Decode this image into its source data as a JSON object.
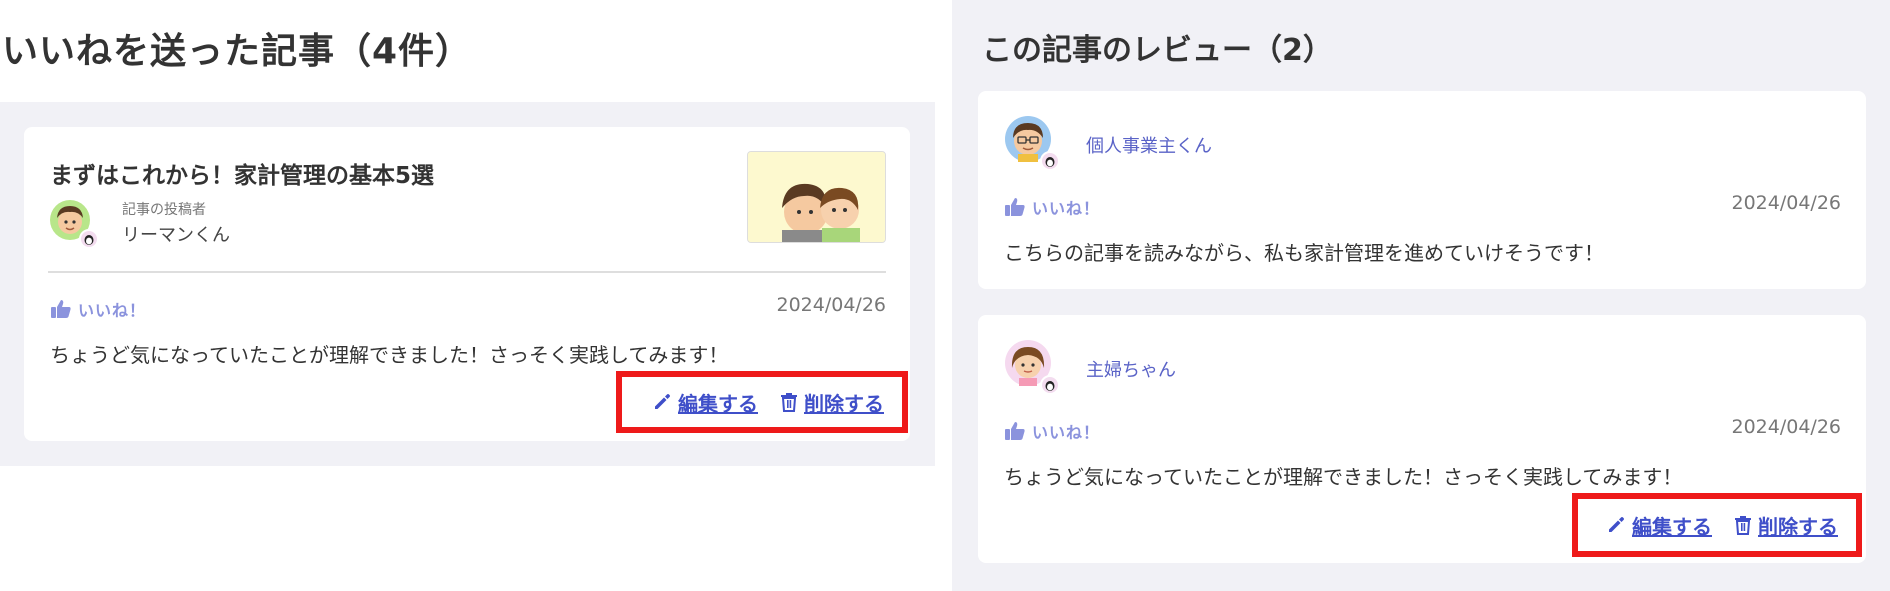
{
  "liked_articles": {
    "heading": "いいねを送った記事（4件）",
    "card": {
      "title": "まずはこれから！家計管理の基本5選",
      "author_label": "記事の投稿者",
      "author_name": "リーマンくん",
      "like_label": "いいね！",
      "date": "2024/04/26",
      "comment": "ちょうど気になっていたことが理解できました！さっそく実践してみます！",
      "edit_label": "編集する",
      "delete_label": "削除する"
    }
  },
  "reviews": {
    "heading": "この記事のレビュー（2）",
    "items": [
      {
        "name": "個人事業主くん",
        "like_label": "いいね！",
        "date": "2024/04/26",
        "comment": "こちらの記事を読みながら、私も家計管理を進めていけそうです！"
      },
      {
        "name": "主婦ちゃん",
        "like_label": "いいね！",
        "date": "2024/04/26",
        "comment": "ちょうど気になっていたことが理解できました！さっそく実践してみます！",
        "edit_label": "編集する",
        "delete_label": "削除する"
      }
    ]
  },
  "colors": {
    "accent": "#3f4fc9",
    "like": "#8b93dd",
    "highlight_border": "#ee1a1a",
    "panel_bg": "#f1f1f6"
  },
  "icons": [
    "thumbs-up-icon",
    "pencil-icon",
    "trash-icon",
    "avatar-icon",
    "badge-icon"
  ]
}
